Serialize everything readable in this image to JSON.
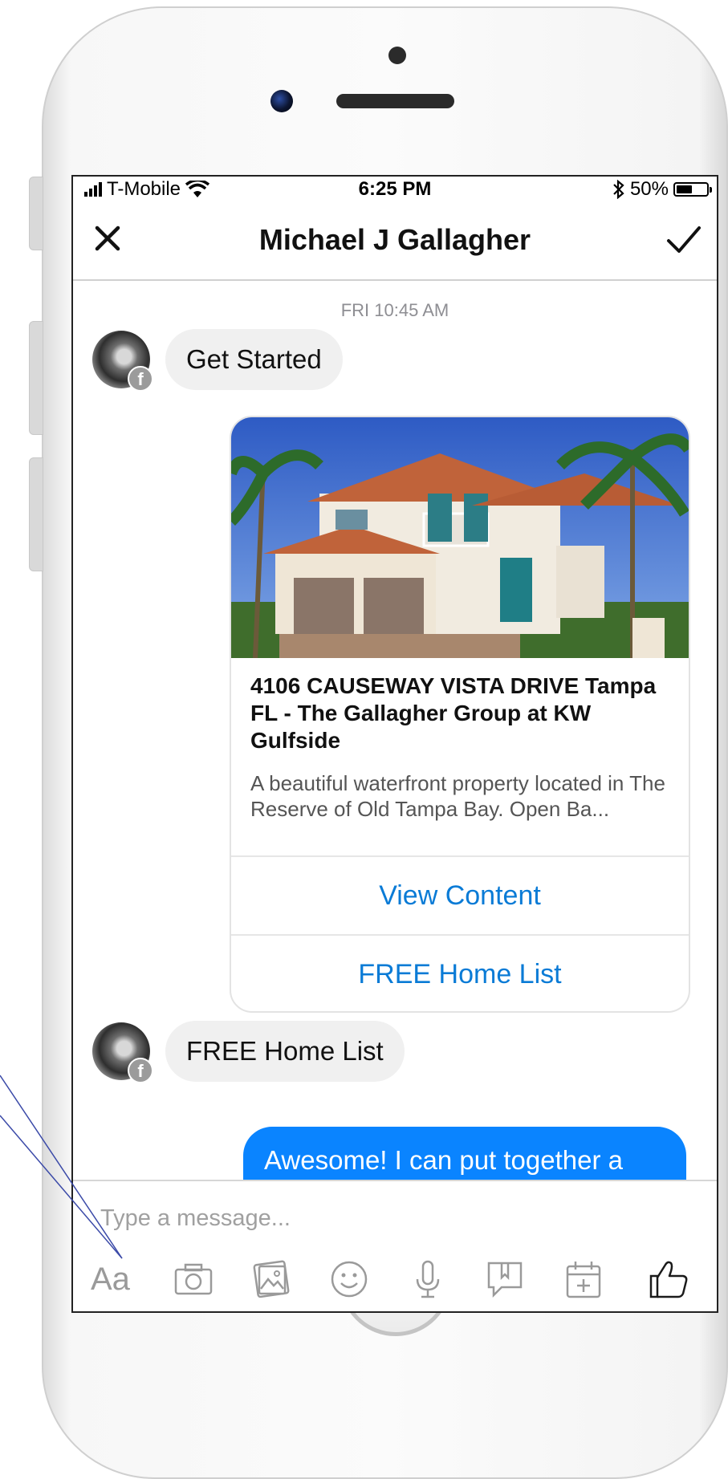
{
  "status_bar": {
    "carrier": "T-Mobile",
    "time": "6:25 PM",
    "battery": "50%"
  },
  "header": {
    "title": "Michael J Gallagher"
  },
  "chat": {
    "timestamp": "FRI 10:45 AM",
    "messages": [
      {
        "from": "user",
        "text": "Get Started"
      },
      {
        "from": "user",
        "text": "FREE Home List"
      }
    ],
    "card": {
      "title": "4106 CAUSEWAY VISTA DRIVE Tampa FL - The Gallagher Group at KW Gulfside",
      "description": "A beautiful waterfront property located in The Reserve of Old Tampa Bay. Open Ba...",
      "buttons": [
        "View Content",
        "FREE Home List"
      ]
    },
    "outgoing": {
      "text": "Awesome! I can put together a custom list of homes just for"
    }
  },
  "composer": {
    "placeholder": "Type a message...",
    "aa_label": "Aa"
  },
  "colors": {
    "accent": "#0a84ff",
    "link": "#0a7bd6"
  }
}
